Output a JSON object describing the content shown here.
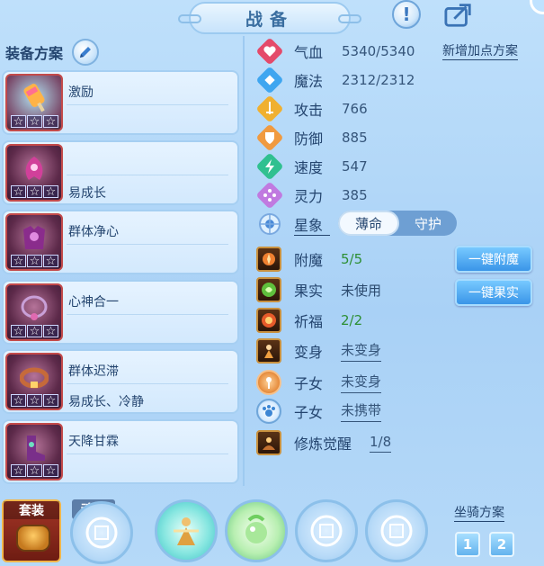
{
  "header": {
    "title": "战备"
  },
  "left_panel": {
    "title": "装备方案",
    "items": [
      {
        "name": "激励",
        "sub": ""
      },
      {
        "name": "",
        "sub": "易成长"
      },
      {
        "name": "群体净心",
        "sub": ""
      },
      {
        "name": "心神合一",
        "sub": ""
      },
      {
        "name": "群体迟滞",
        "sub": "易成长、冷静"
      },
      {
        "name": "天降甘霖",
        "sub": ""
      }
    ],
    "star_glyph": "☆"
  },
  "stats": {
    "add_plan_label": "新增加点方案",
    "rows": [
      {
        "label": "气血",
        "value": "5340/5340",
        "icon": "heart-icon",
        "color": "#e44a6a"
      },
      {
        "label": "魔法",
        "value": "2312/2312",
        "icon": "diamond-icon",
        "color": "#3fa6f0"
      },
      {
        "label": "攻击",
        "value": "766",
        "icon": "sword-icon",
        "color": "#f0b030"
      },
      {
        "label": "防御",
        "value": "885",
        "icon": "shield-icon",
        "color": "#f09a40"
      },
      {
        "label": "速度",
        "value": "547",
        "icon": "lightning-icon",
        "color": "#30c090"
      },
      {
        "label": "灵力",
        "value": "385",
        "icon": "sparkle-icon",
        "color": "#c07ae0"
      }
    ],
    "star_label": "星象",
    "star_options": [
      "薄命",
      "守护"
    ],
    "star_selected": "薄命"
  },
  "enhancements": [
    {
      "label": "附魔",
      "value": "5/5",
      "style": "green",
      "icon": "enchant-icon"
    },
    {
      "label": "果实",
      "value": "未使用",
      "style": "plain",
      "icon": "fruit-icon"
    },
    {
      "label": "祈福",
      "value": "2/2",
      "style": "green",
      "icon": "bless-icon"
    },
    {
      "label": "变身",
      "value": "未变身",
      "style": "under",
      "icon": "transform-icon"
    },
    {
      "label": "子女",
      "value": "未变身",
      "style": "under",
      "icon": "child-icon"
    },
    {
      "label": "子女",
      "value": "未携带",
      "style": "under",
      "icon": "paw-icon"
    },
    {
      "label": "修炼觉醒",
      "value": "1/8",
      "style": "under",
      "icon": "cultivate-icon"
    }
  ],
  "actions": {
    "one_click_enchant": "一键附魔",
    "one_click_fruit": "一键果实"
  },
  "bottom": {
    "suit_tab": "套装",
    "soul_skill_tab": "魂技",
    "mount_plan_title": "坐骑方案",
    "mount_plans": [
      "1",
      "2"
    ]
  }
}
